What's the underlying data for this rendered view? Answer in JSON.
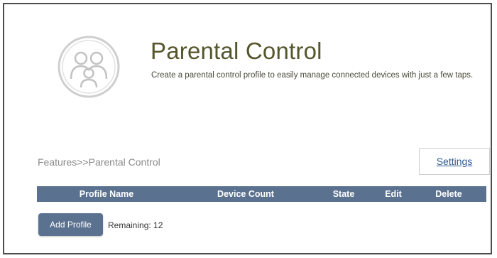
{
  "page": {
    "title": "Parental Control",
    "subtitle": "Create a parental control profile to easily manage connected devices with just a few taps.",
    "logo_icon": "family-icon"
  },
  "breadcrumb": "Features>>Parental Control",
  "settings_label": "Settings",
  "table": {
    "columns": [
      "Profile Name",
      "Device Count",
      "State",
      "Edit",
      "Delete"
    ],
    "rows": []
  },
  "actions": {
    "add_profile_label": "Add Profile",
    "remaining_label": "Remaining:",
    "remaining_value": "12"
  },
  "colors": {
    "header_bg": "#5b7190",
    "title": "#55552e",
    "link": "#2f5c8f"
  }
}
